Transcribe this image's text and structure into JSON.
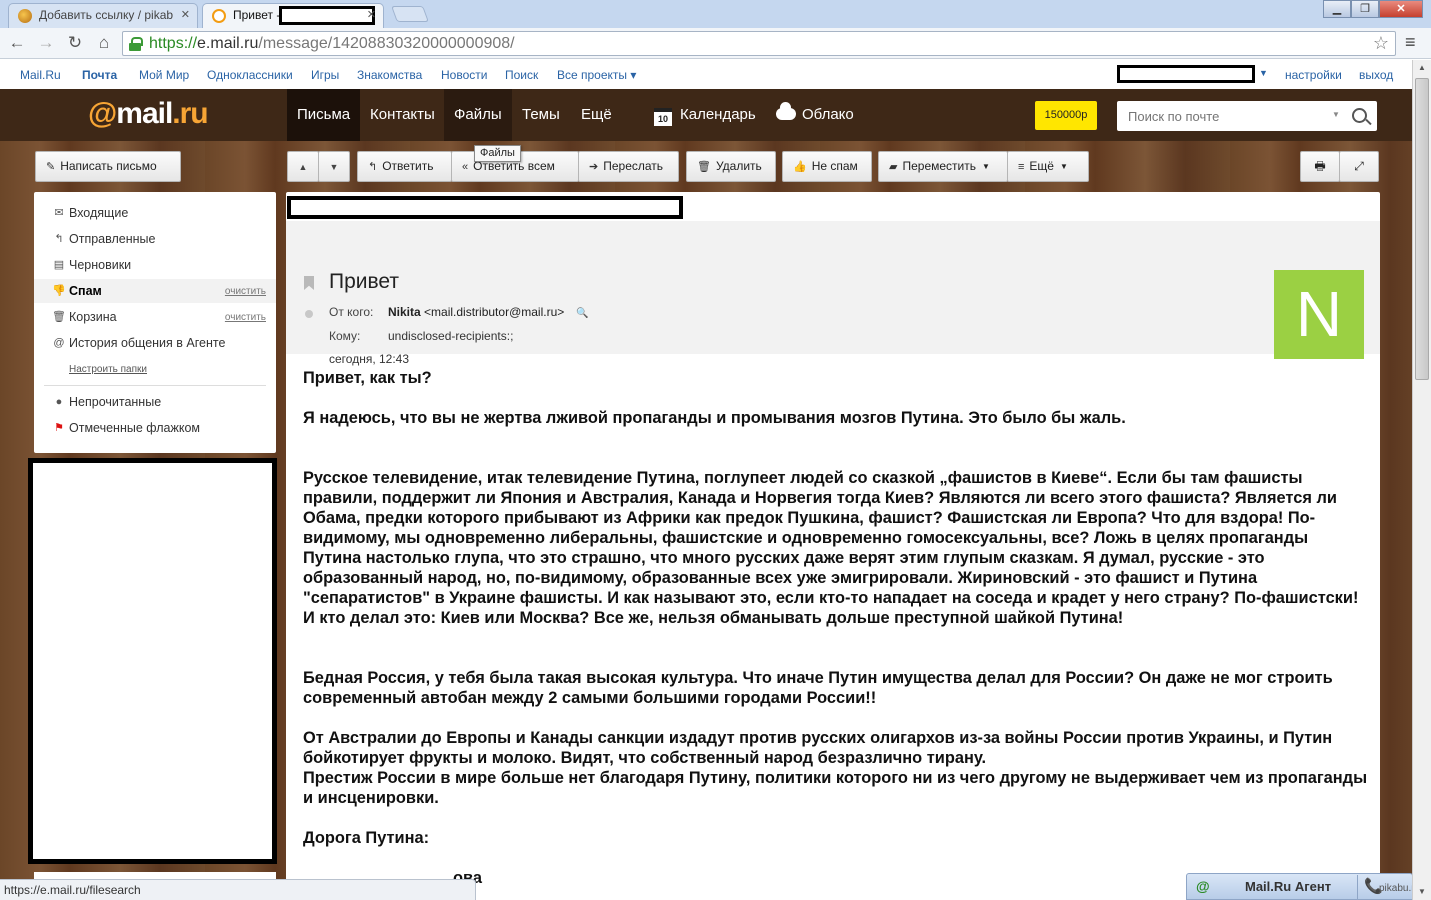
{
  "browser": {
    "tabs": [
      {
        "title": "Добавить ссылку / pikab",
        "close": "✕"
      },
      {
        "title": "Привет -",
        "close": "✕"
      }
    ],
    "url": {
      "scheme": "https://",
      "host": "e.mail.ru",
      "path": "/message/14208830320000000908/"
    }
  },
  "portal": {
    "links": [
      "Mail.Ru",
      "Почта",
      "Мой Мир",
      "Одноклассники",
      "Игры",
      "Знакомства",
      "Новости",
      "Поиск",
      "Все проекты"
    ],
    "settings": "настройки",
    "logout": "выход"
  },
  "header": {
    "logo": {
      "at": "@",
      "mail": "mail",
      "ru": ".ru"
    },
    "nav": [
      "Письма",
      "Контакты",
      "Файлы",
      "Темы",
      "Ещё",
      "Календарь",
      "Облако"
    ],
    "calendar_day": "10",
    "promo": "150000р",
    "search_placeholder": "Поиск по почте"
  },
  "toolbar": {
    "compose": "Написать письмо",
    "reply": "Ответить",
    "reply_all": "Ответить всем",
    "forward": "Переслать",
    "delete": "Удалить",
    "not_spam": "Не спам",
    "move": "Переместить",
    "more": "Ещё",
    "tooltip": "Файлы"
  },
  "sidebar": {
    "folders": [
      {
        "label": "Входящие",
        "icon": "envelope-icon"
      },
      {
        "label": "Отправленные",
        "icon": "reply-icon"
      },
      {
        "label": "Черновики",
        "icon": "draft-icon"
      },
      {
        "label": "Спам",
        "icon": "thumbs-down-icon",
        "clear": "очистить"
      },
      {
        "label": "Корзина",
        "icon": "trash-icon",
        "clear": "очистить"
      },
      {
        "label": "История общения в Агенте",
        "icon": "at-icon"
      }
    ],
    "configure": "Настроить папки",
    "filters": [
      {
        "label": "Непрочитанные",
        "icon": "dot-icon"
      },
      {
        "label": "Отмеченные флажком",
        "icon": "flag-icon"
      }
    ]
  },
  "message": {
    "subject": "Привет",
    "from_label": "От кого:",
    "from_name": "Nikita",
    "from_email": "<mail.distributor@mail.ru>",
    "to_label": "Кому:",
    "to_value": "undisclosed-recipients:;",
    "date": "сегодня, 12:43",
    "avatar_letter": "N",
    "body": [
      "Привет, как ты?",
      "Я надеюсь, что вы не жертва лживой пропаганды и промывания мозгов Путина. Это было бы жаль.",
      "Русское телевидение, итак телевидение Путина, поглупеет людей со сказкой „фашистов в Киеве“. Если бы там фашисты правили, поддержит ли Япония и Австралия, Канада и Норвегия тогда Киев? Являются ли всего этого фашиста? Является ли Обама, предки которого прибывают из Африки как предок Пушкина, фашист? Фашистская ли Европа? Что для вздора! По-видимому, мы одновременно либеральны, фашистские и одновременно гомосексуальны, все? Ложь в целях пропаганды Путина настолько глупа, что это страшно, что много русских даже верят этим глупым сказкам. Я думал, русские - это образованный народ, но, по-видимому, образованные всех уже эмигрировали. Жириновский - это фашист и Путина \"сепаратистов\" в Украине фашисты. И как называют это, если кто-то нападает на соседа и крадет у него страну? По-фашистски! И кто делал это: Киев или Москва? Все же, нельзя обманывать дольше преступной шайкой Путина!",
      "Бедная Россия, у тебя была такая высокая культура. Что иначе Путин имущества делал для России? Он даже не мог строить современный автобан между 2 самыми большими городами России!!",
      "От Австралии до Европы и Канады санкции издадут против русских олигархов из-за войны России против Украины, и Путин бойкотирует фрукты и молоко. Видят, что собственный народ безразлично тирану.",
      "Престиж России в мире больше нет благодаря Путину, политики которого ни из чего другому не выдерживает чем из пропаганды и инсценировки.",
      "Дорога Путина:",
      "ова"
    ]
  },
  "statusbar": "https://e.mail.ru/filesearch",
  "agent": {
    "label": "Mail.Ru Агент",
    "at": "@"
  },
  "watermark": "pikabu.ru"
}
